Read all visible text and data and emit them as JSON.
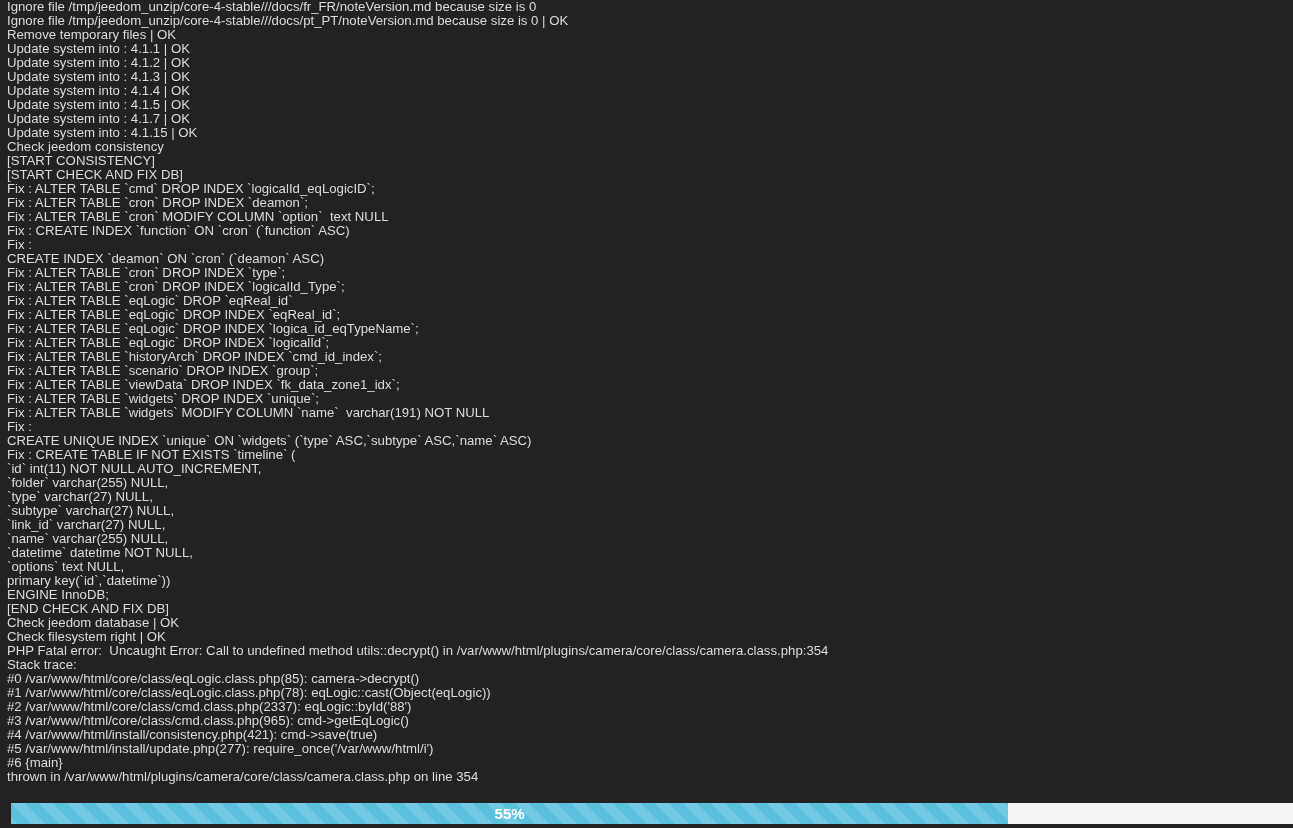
{
  "log": {
    "lines": [
      "Ignore file /tmp/jeedom_unzip/core-4-stable///docs/fr_FR/noteVersion.md because size is 0",
      "Ignore file /tmp/jeedom_unzip/core-4-stable///docs/pt_PT/noteVersion.md because size is 0 | OK",
      "Remove temporary files | OK",
      "Update system into : 4.1.1 | OK",
      "Update system into : 4.1.2 | OK",
      "Update system into : 4.1.3 | OK",
      "Update system into : 4.1.4 | OK",
      "Update system into : 4.1.5 | OK",
      "Update system into : 4.1.7 | OK",
      "Update system into : 4.1.15 | OK",
      "Check jeedom consistency",
      "[START CONSISTENCY]",
      "[START CHECK AND FIX DB]",
      "Fix : ALTER TABLE `cmd` DROP INDEX `logicalId_eqLogicID`;",
      "Fix : ALTER TABLE `cron` DROP INDEX `deamon`;",
      "Fix : ALTER TABLE `cron` MODIFY COLUMN `option`  text NULL",
      "Fix : CREATE INDEX `function` ON `cron` (`function` ASC)",
      "Fix :",
      "CREATE INDEX `deamon` ON `cron` (`deamon` ASC)",
      "Fix : ALTER TABLE `cron` DROP INDEX `type`;",
      "Fix : ALTER TABLE `cron` DROP INDEX `logicalId_Type`;",
      "Fix : ALTER TABLE `eqLogic` DROP `eqReal_id`",
      "Fix : ALTER TABLE `eqLogic` DROP INDEX `eqReal_id`;",
      "Fix : ALTER TABLE `eqLogic` DROP INDEX `logica_id_eqTypeName`;",
      "Fix : ALTER TABLE `eqLogic` DROP INDEX `logicalId`;",
      "Fix : ALTER TABLE `historyArch` DROP INDEX `cmd_id_index`;",
      "Fix : ALTER TABLE `scenario` DROP INDEX `group`;",
      "Fix : ALTER TABLE `viewData` DROP INDEX `fk_data_zone1_idx`;",
      "Fix : ALTER TABLE `widgets` DROP INDEX `unique`;",
      "Fix : ALTER TABLE `widgets` MODIFY COLUMN `name`  varchar(191) NOT NULL",
      "Fix :",
      "CREATE UNIQUE INDEX `unique` ON `widgets` (`type` ASC,`subtype` ASC,`name` ASC)",
      "Fix : CREATE TABLE IF NOT EXISTS `timeline` (",
      "`id` int(11) NOT NULL AUTO_INCREMENT,",
      "`folder` varchar(255) NULL,",
      "`type` varchar(27) NULL,",
      "`subtype` varchar(27) NULL,",
      "`link_id` varchar(27) NULL,",
      "`name` varchar(255) NULL,",
      "`datetime` datetime NOT NULL,",
      "`options` text NULL,",
      "primary key(`id`,`datetime`))",
      "ENGINE InnoDB;",
      "[END CHECK AND FIX DB]",
      "Check jeedom database | OK",
      "Check filesystem right | OK",
      "PHP Fatal error:  Uncaught Error: Call to undefined method utils::decrypt() in /var/www/html/plugins/camera/core/class/camera.class.php:354",
      "Stack trace:",
      "#0 /var/www/html/core/class/eqLogic.class.php(85): camera->decrypt()",
      "#1 /var/www/html/core/class/eqLogic.class.php(78): eqLogic::cast(Object(eqLogic))",
      "#2 /var/www/html/core/class/cmd.class.php(2337): eqLogic::byId('88')",
      "#3 /var/www/html/core/class/cmd.class.php(965): cmd->getEqLogic()",
      "#4 /var/www/html/install/consistency.php(421): cmd->save(true)",
      "#5 /var/www/html/install/update.php(277): require_once('/var/www/html/i')",
      "#6 {main}",
      "thrown in /var/www/html/plugins/camera/core/class/camera.class.php on line 354"
    ]
  },
  "progress": {
    "level": 0.55,
    "label": "55%"
  }
}
